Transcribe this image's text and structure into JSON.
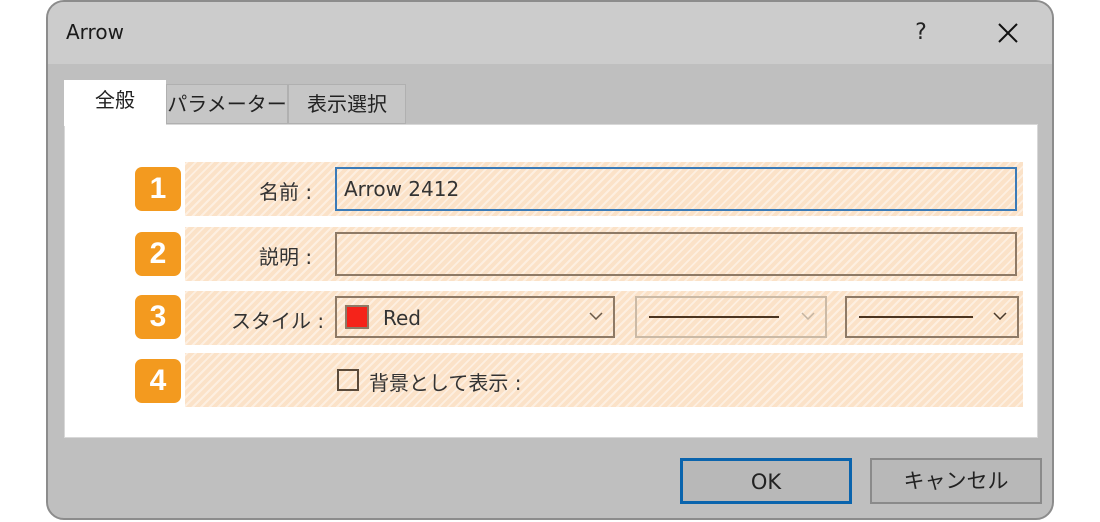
{
  "window": {
    "title": "Arrow",
    "help_label": "?",
    "close_icon": "close-icon"
  },
  "tabs": [
    {
      "label": "全般",
      "active": true
    },
    {
      "label": "パラメーター",
      "active": false
    },
    {
      "label": "表示選択",
      "active": false
    }
  ],
  "rows": [
    {
      "number": "1",
      "label": "名前 :",
      "value": "Arrow 2412"
    },
    {
      "number": "2",
      "label": "説明 :",
      "value": ""
    },
    {
      "number": "3",
      "label": "スタイル :",
      "color_name": "Red",
      "color_hex": "#f5231a",
      "line_style": "solid",
      "line_width": "thin"
    },
    {
      "number": "4",
      "checkbox_label": "背景として表示 :",
      "checked": false
    }
  ],
  "buttons": {
    "ok": "OK",
    "cancel": "キャンセル"
  },
  "colors": {
    "accent_number": "#f39a1f",
    "focus_border": "#3b7bb8",
    "ok_border": "#0a64ad"
  }
}
